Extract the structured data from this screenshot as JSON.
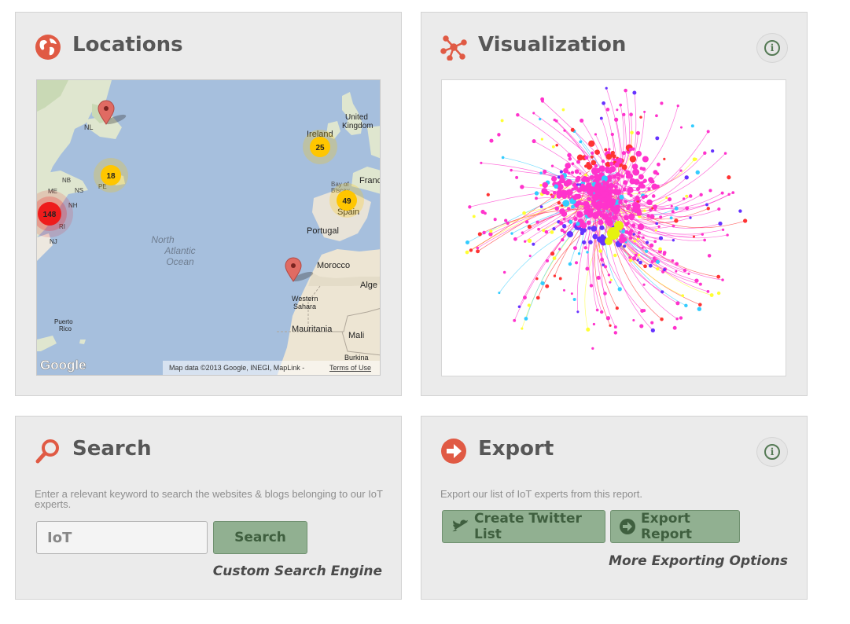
{
  "colors": {
    "accent": "#e05a44",
    "panel_bg": "#ebebeb",
    "button_green": "#91b091",
    "button_text": "#3f5f3f",
    "cluster_red": "#ee1c1c",
    "cluster_yellow": "#ffc600"
  },
  "locations": {
    "title": "Locations",
    "icon": "globe-icon",
    "map": {
      "labels": {
        "nl": "NL",
        "pe": "PE",
        "nb": "NB",
        "ns": "NS",
        "me": "ME",
        "nh": "NH",
        "ri": "RI",
        "nj": "NJ",
        "ireland": "Ireland",
        "uk": "United Kingdom",
        "france": "Franc",
        "bay": "Bay of Biscay",
        "spain": "Spain",
        "portugal": "Portugal",
        "morocco": "Morocco",
        "alge": "Alge",
        "western_sahara": "Western Sahara",
        "mauritania": "Mauritania",
        "mali": "Mali",
        "burkina": "Burkina Faso",
        "ocean": "North Atlantic Ocean",
        "puerto_rico": "Puerto Rico",
        "logo": "Google",
        "attribution": "Map data ©2013 Google, INEGI, MapLink - ",
        "terms": "Terms of Use"
      },
      "clusters": [
        {
          "label": "148",
          "color": "red"
        },
        {
          "label": "18",
          "color": "yellow"
        },
        {
          "label": "25",
          "color": "yellow"
        },
        {
          "label": "49",
          "color": "yellow"
        }
      ],
      "markers": 2
    }
  },
  "visualization": {
    "title": "Visualization",
    "icon": "network-icon",
    "info_icon": "info-icon"
  },
  "search": {
    "title": "Search",
    "icon": "magnifier-icon",
    "description": "Enter a relevant keyword to search the websites & blogs belonging to our IoT experts.",
    "input_value": "IoT",
    "button_label": "Search",
    "link": "Custom Search Engine"
  },
  "export": {
    "title": "Export",
    "icon": "arrow-circle-icon",
    "info_icon": "info-icon",
    "description": "Export our list of IoT experts from this report.",
    "twitter_button": "Create Twitter List",
    "export_button": "Export Report",
    "link": "More Exporting Options"
  }
}
